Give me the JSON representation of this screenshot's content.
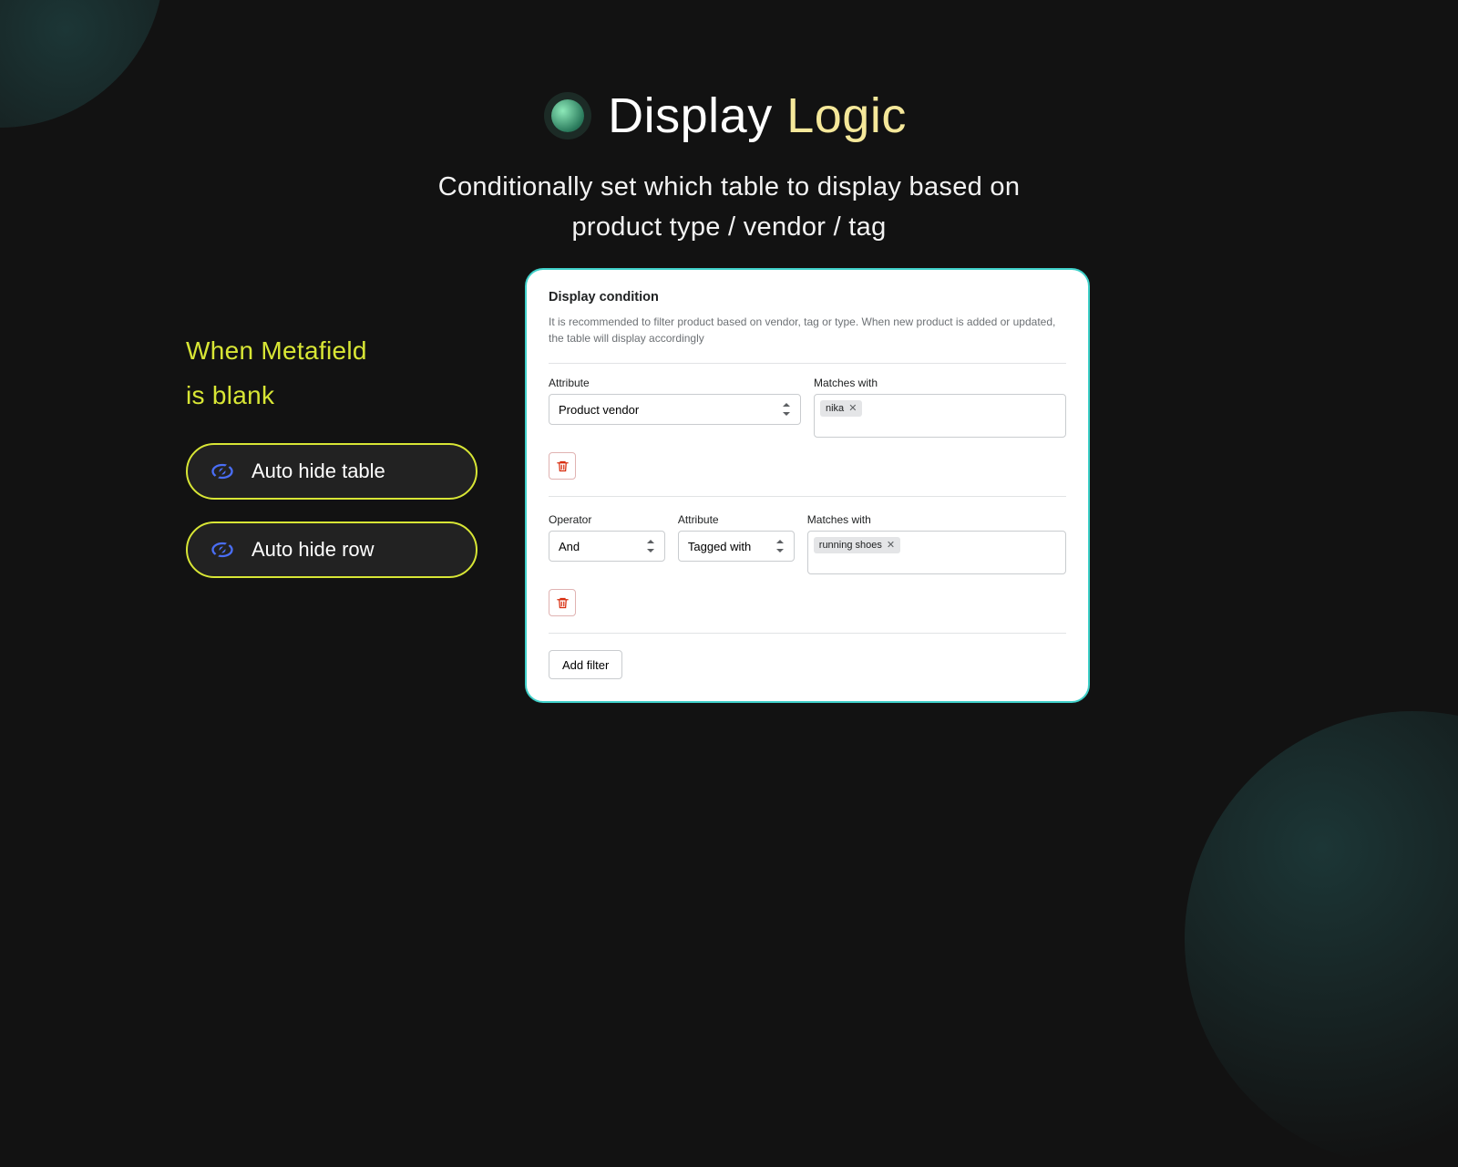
{
  "hero": {
    "title_prefix": "Display",
    "title_accent": "Logic",
    "subtitle": "Conditionally set which table to display based on\nproduct type / vendor / tag"
  },
  "sidebar": {
    "heading": "When Metafield\nis blank",
    "pills": [
      {
        "label": "Auto hide table"
      },
      {
        "label": "Auto hide row"
      }
    ]
  },
  "panel": {
    "title": "Display condition",
    "description": "It is recommended to filter product based on vendor, tag or type. When new product is added or updated, the table will display accordingly",
    "labels": {
      "attribute": "Attribute",
      "matches": "Matches with",
      "operator": "Operator"
    },
    "filters": [
      {
        "attribute": "Product vendor",
        "tags": [
          "nika"
        ]
      },
      {
        "operator": "And",
        "attribute": "Tagged with",
        "tags": [
          "running shoes"
        ]
      }
    ],
    "add_filter": "Add filter"
  }
}
